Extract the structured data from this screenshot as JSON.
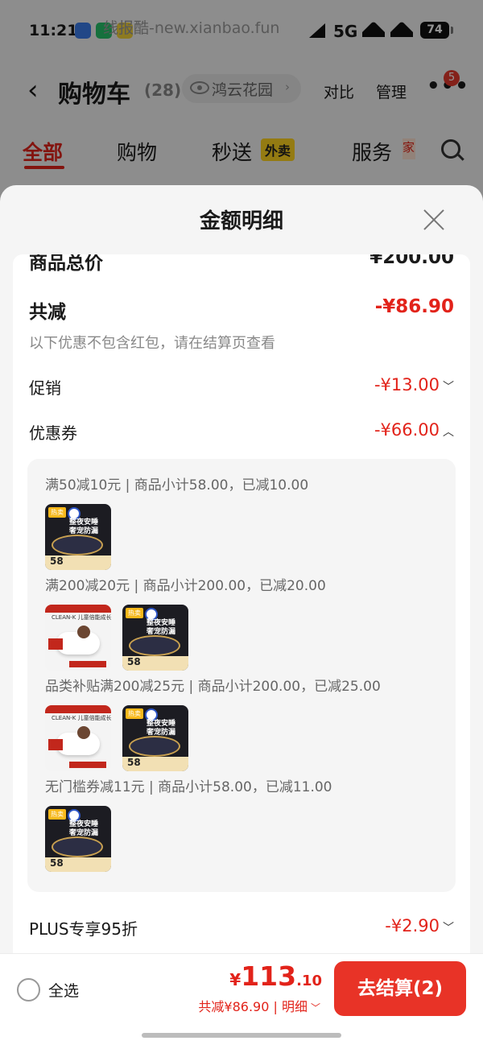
{
  "status_bar": {
    "time": "11:21",
    "watermark": "线报酷-new.xianbao.fun",
    "network": "5G",
    "battery": "74"
  },
  "nav": {
    "title": "购物车",
    "count": "(28)",
    "location": "鸿云花园",
    "compare": "对比",
    "manage": "管理",
    "more_badge": "5"
  },
  "tabs": [
    {
      "label": "全部"
    },
    {
      "label": "购物"
    },
    {
      "label": "秒送",
      "badge": "外卖"
    },
    {
      "label": "服务",
      "badge": "家"
    }
  ],
  "sheet": {
    "title": "金额明细",
    "goods_total_label": "商品总价",
    "goods_total_value": "¥200.00",
    "total_reduction_label": "共减",
    "total_reduction_value": "-¥86.90",
    "note": "以下优惠不包含红包，请在结算页查看",
    "promotion_label": "促销",
    "promotion_value": "-¥13.00",
    "coupon_label": "优惠券",
    "coupon_value": "-¥66.00",
    "coupon_rules": [
      {
        "text": "满50减10元 | 商品小计58.00，已减10.00",
        "items": [
          {
            "type": "dark",
            "price": "58"
          }
        ]
      },
      {
        "text": "满200减20元 | 商品小计200.00，已减20.00",
        "items": [
          {
            "type": "light",
            "brand": "CLEAN-K 儿童倍能成长裤"
          },
          {
            "type": "dark",
            "price": "58"
          }
        ]
      },
      {
        "text": "品类补贴满200减25元 | 商品小计200.00，已减25.00",
        "items": [
          {
            "type": "light",
            "brand": "CLEAN-K 儿童倍能成长裤"
          },
          {
            "type": "dark",
            "price": "58"
          }
        ]
      },
      {
        "text": "无门槛券减11元 | 商品小计58.00，已减11.00",
        "items": [
          {
            "type": "dark",
            "price": "58"
          }
        ]
      }
    ],
    "plus_label": "PLUS专享95折",
    "plus_value": "-¥2.90"
  },
  "thumb_caption": "整夜安睡\n奢宠防漏",
  "thumb_tag": "热卖",
  "bottom": {
    "select_all": "全选",
    "currency": "¥",
    "total_int": "113",
    "total_dec": ".10",
    "saved": "共减¥86.90 | 明细",
    "checkout": "去结算(2)"
  },
  "colors": {
    "accent": "#e2231a",
    "checkout_bg": "#e83327",
    "overlay": "rgba(0,0,0,0.42)"
  }
}
